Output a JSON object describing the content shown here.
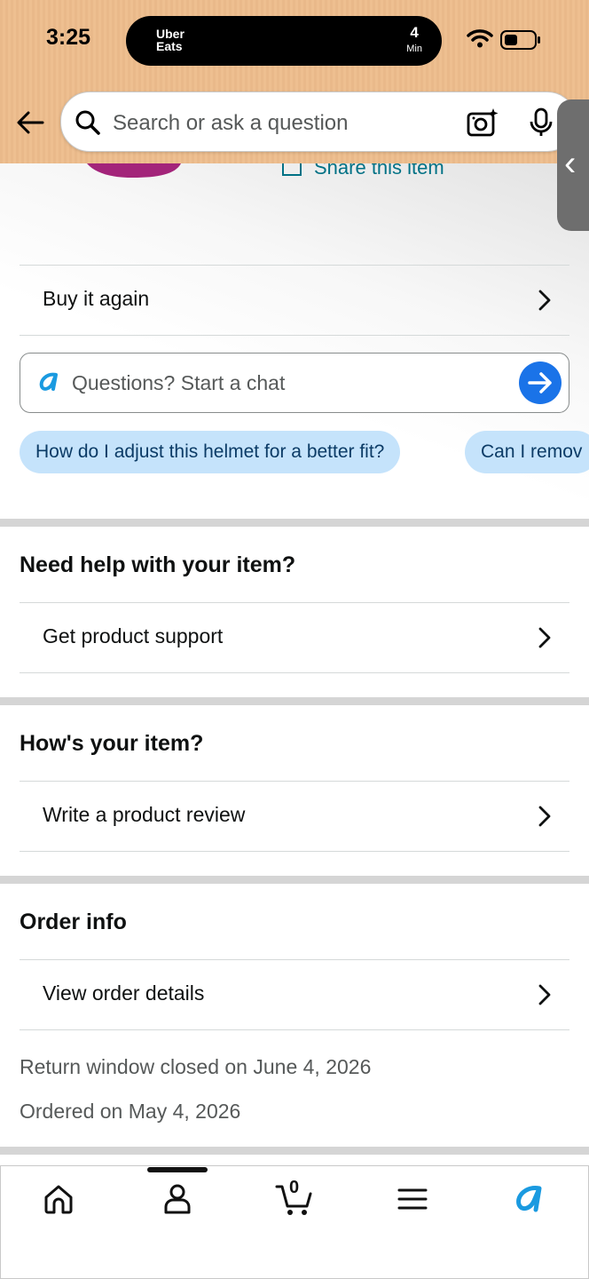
{
  "status_bar": {
    "time": "3:25",
    "live_activity": {
      "brand_line1": "Uber",
      "brand_line2": "Eats",
      "eta_value": "4",
      "eta_unit": "Min"
    }
  },
  "header": {
    "search_placeholder": "Search or ask a question",
    "back_icon": "arrow-left-icon",
    "camera_icon": "camera-sparkle-icon",
    "mic_icon": "microphone-icon"
  },
  "share": {
    "label": "Share this item"
  },
  "buy_again": {
    "label": "Buy it again"
  },
  "chat": {
    "placeholder": "Questions? Start a chat",
    "chips": [
      "How do I adjust this helmet for a better fit?",
      "Can I remov"
    ]
  },
  "help_section": {
    "title": "Need help with your item?",
    "row_label": "Get product support"
  },
  "review_section": {
    "title": "How's your item?",
    "row_label": "Write a product review"
  },
  "order_section": {
    "title": "Order info",
    "row_label": "View order details",
    "return_text": "Return window closed on June 4, 2026",
    "ordered_text": "Ordered on May 4, 2026"
  },
  "tab_bar": {
    "items": [
      "home-icon",
      "account-icon",
      "cart-icon",
      "menu-icon",
      "rufus-icon"
    ],
    "cart_count": "0",
    "active_index": 1
  },
  "colors": {
    "link": "#007185",
    "chip_bg": "#c5e3fb",
    "send_button": "#1a73e8",
    "header_bg": "#e9b98a"
  }
}
